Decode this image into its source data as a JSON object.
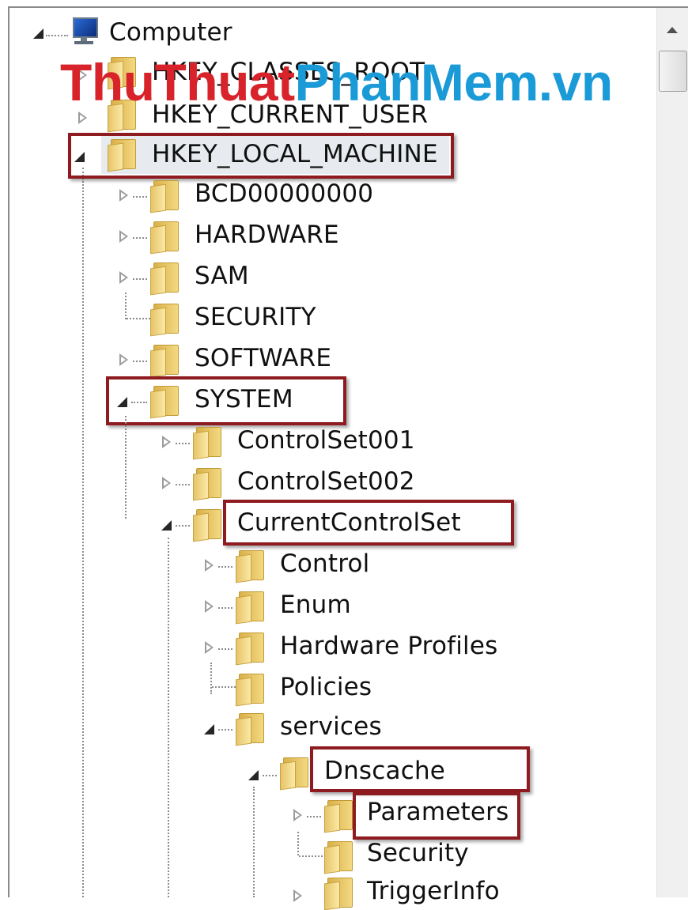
{
  "watermark": {
    "part1": "ThuThuat",
    "part2": "PhanMem.vn"
  },
  "colors": {
    "highlight": "#8e1b1f",
    "watermark_red": "#d8232a",
    "watermark_blue": "#1a9ad6"
  },
  "tree": {
    "root": "Computer",
    "hkcr": "HKEY_CLASSES_ROOT",
    "hkcu": "HKEY_CURRENT_USER",
    "hklm": "HKEY_LOCAL_MACHINE",
    "hklm_children": {
      "bcd": "BCD00000000",
      "hardware": "HARDWARE",
      "sam": "SAM",
      "security": "SECURITY",
      "software": "SOFTWARE",
      "system": "SYSTEM"
    },
    "system_children": {
      "cs1": "ControlSet001",
      "cs2": "ControlSet002",
      "ccs": "CurrentControlSet"
    },
    "ccs_children": {
      "control": "Control",
      "enum": "Enum",
      "hwprofiles": "Hardware Profiles",
      "policies": "Policies",
      "services": "services"
    },
    "services_children": {
      "dnscache": "Dnscache"
    },
    "dnscache_children": {
      "parameters": "Parameters",
      "security": "Security",
      "triggerinfo": "TriggerInfo"
    }
  }
}
